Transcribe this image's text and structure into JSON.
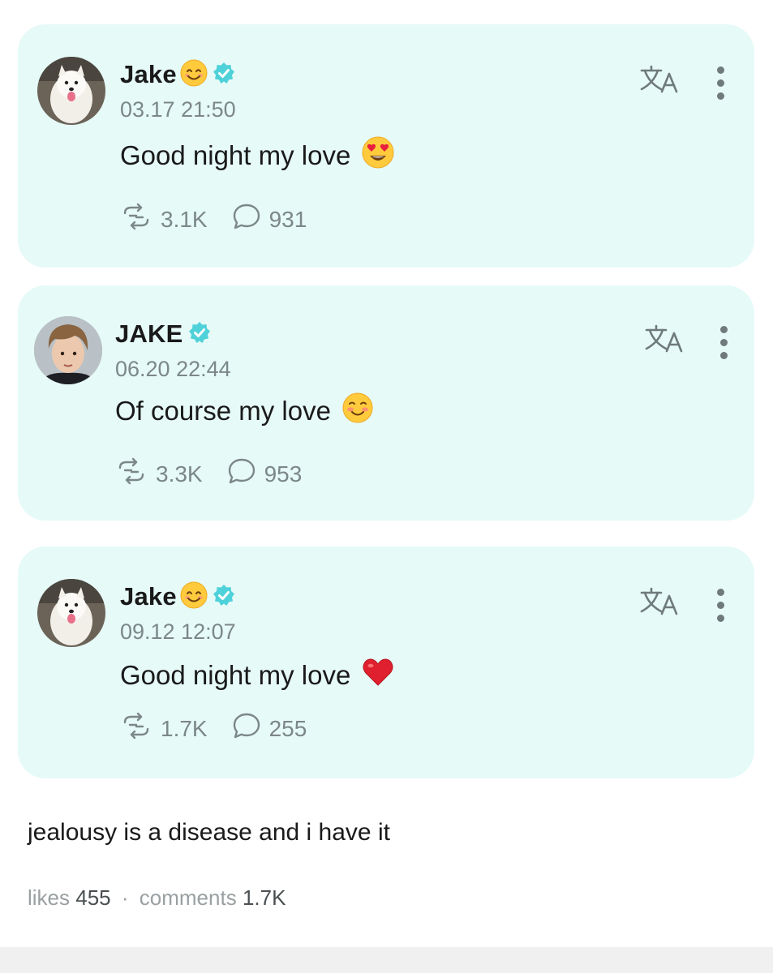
{
  "posts": [
    {
      "name": "Jake",
      "name_emoji": "smiling-face-icon",
      "time": "03.17 21:50",
      "text": "Good night my love",
      "text_emoji": "heart-eyes-icon",
      "reposts": "3.1K",
      "comments": "931"
    },
    {
      "name": "JAKE",
      "time": "06.20 22:44",
      "text": "Of course my love",
      "text_emoji": "blushing-smile-icon",
      "reposts": "3.3K",
      "comments": "953"
    },
    {
      "name": "Jake",
      "name_emoji": "smiling-face-icon",
      "time": "09.12 12:07",
      "text": "Good night my love",
      "text_emoji": "red-heart-icon",
      "reposts": "1.7K",
      "comments": "255"
    }
  ],
  "caption": "jealousy is a disease and i have it",
  "footer": {
    "likes_label": "likes",
    "likes_count": "455",
    "separator": "·",
    "comments_label": "comments",
    "comments_count": "1.7K"
  },
  "colors": {
    "card_bg": "#e6faf7",
    "verify_badge": "#4fd1d9",
    "meta_gray": "#7c8789"
  }
}
